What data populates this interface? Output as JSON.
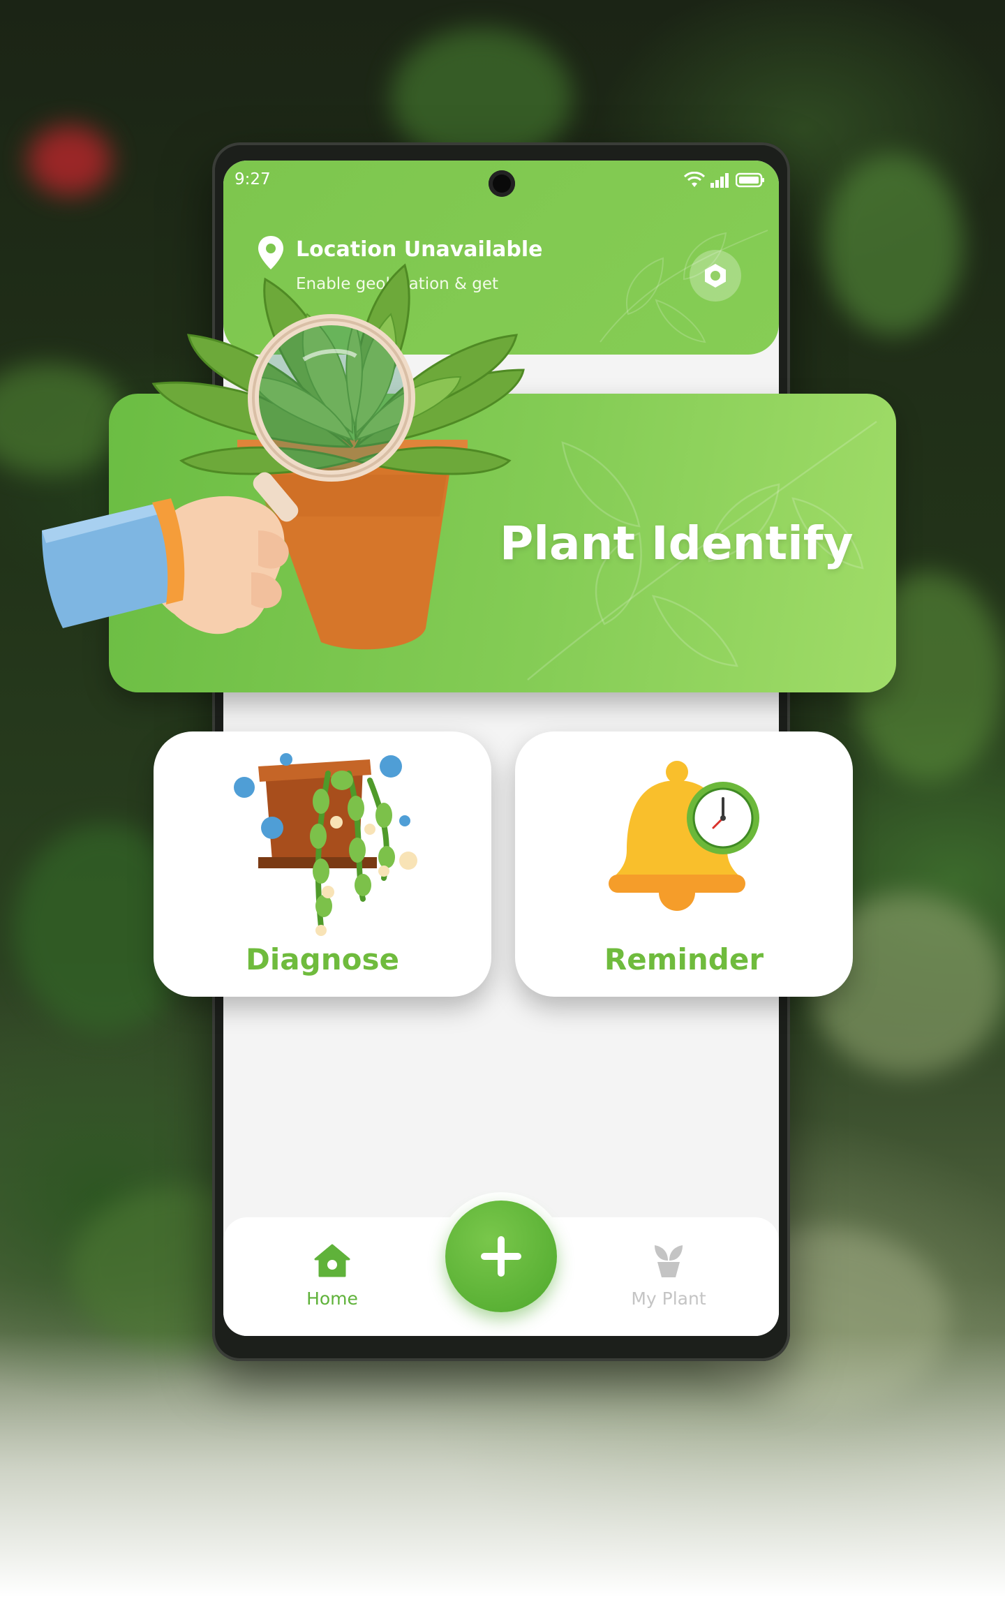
{
  "status_bar": {
    "time": "9:27"
  },
  "header": {
    "location_title": "Location Unavailable",
    "location_subtitle": "Enable geolocation & get",
    "icons": [
      "location-pin-icon",
      "settings-hex-icon"
    ]
  },
  "banner": {
    "title": "Plant Identify",
    "art": "hand-magnifier-succulent"
  },
  "cards": [
    {
      "label": "Diagnose",
      "art": "diseased-plant-virus"
    },
    {
      "label": "Reminder",
      "art": "bell-clock"
    }
  ],
  "bottom_nav": {
    "items": [
      {
        "label": "Home",
        "icon": "home-icon",
        "active": true
      },
      {
        "label": "My Plant",
        "icon": "potted-plant-icon",
        "active": false
      }
    ],
    "fab_icon": "plus-icon"
  },
  "colors": {
    "primary_green": "#7dc64e",
    "label_green": "#6fbb3d",
    "bell_yellow": "#f9bf2c",
    "inactive_gray": "#c4c4c4"
  }
}
